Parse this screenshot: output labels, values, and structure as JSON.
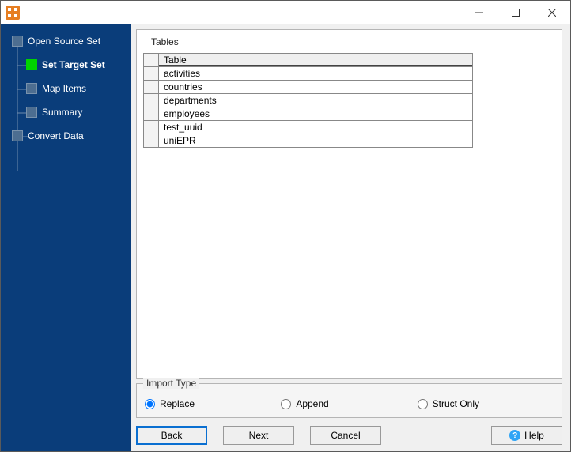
{
  "window": {
    "title": ""
  },
  "sidebar": {
    "items": [
      {
        "label": "Open Source Set",
        "level": 0,
        "active": false
      },
      {
        "label": "Set Target Set",
        "level": 1,
        "active": true
      },
      {
        "label": "Map Items",
        "level": 1,
        "active": false
      },
      {
        "label": "Summary",
        "level": 1,
        "active": false
      },
      {
        "label": "Convert Data",
        "level": 0,
        "active": false
      }
    ]
  },
  "main": {
    "tables_label": "Tables",
    "grid": {
      "column_header": "Table",
      "rows": [
        "activities",
        "countries",
        "departments",
        "employees",
        "test_uuid",
        "uniEPR"
      ]
    },
    "import_type": {
      "legend": "Import Type",
      "options": [
        {
          "label": "Replace",
          "value": "replace",
          "selected": true
        },
        {
          "label": "Append",
          "value": "append",
          "selected": false
        },
        {
          "label": "Struct Only",
          "value": "structonly",
          "selected": false
        }
      ]
    },
    "buttons": {
      "back": "Back",
      "next": "Next",
      "cancel": "Cancel",
      "help": "Help"
    }
  }
}
